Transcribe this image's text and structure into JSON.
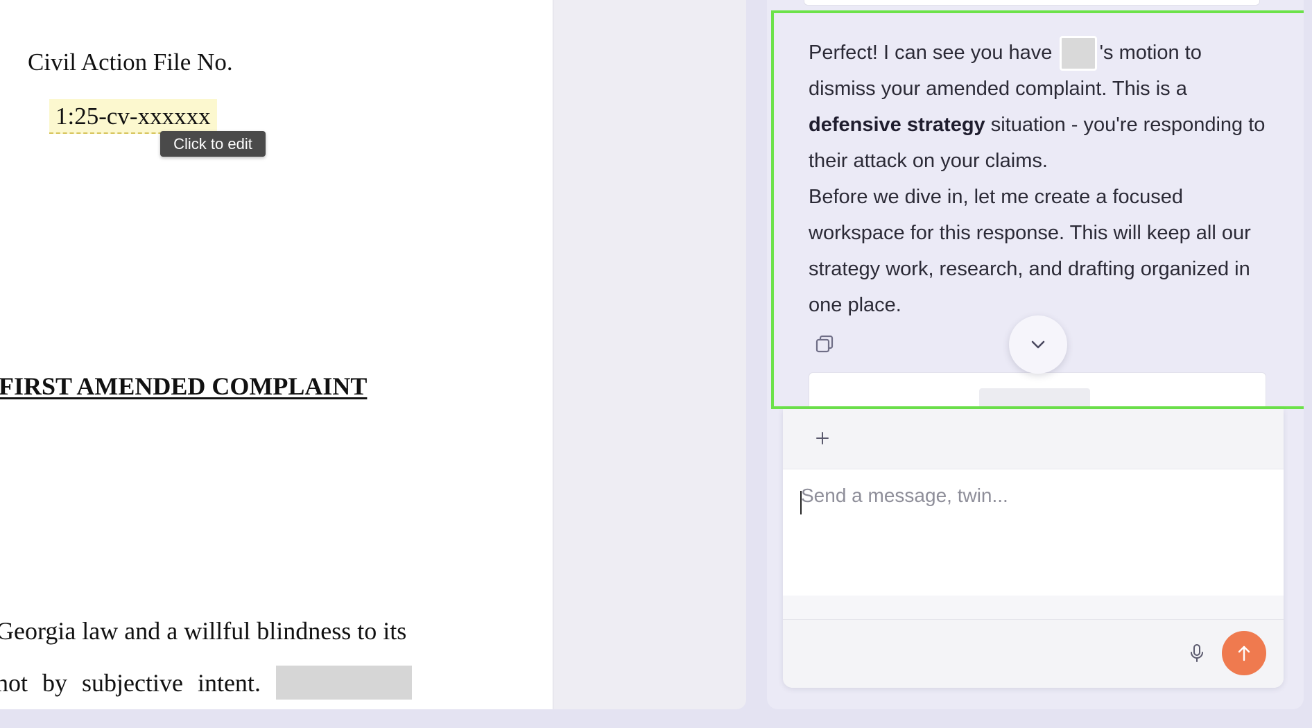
{
  "document": {
    "file_label": "Civil Action File No.",
    "case_number": "1:25-cv-xxxxxx",
    "tooltip": "Click to edit",
    "heading": "FIRST AMENDED COMPLAINT",
    "line_1": "Georgia law and a willful blindness to its",
    "line_2": "not by subjective intent."
  },
  "chat": {
    "message": {
      "p1_before": "Perfect! I can see you have ",
      "p1_after": "'s motion to dismiss your amended complaint. This is a ",
      "p1_bold": "defensive strategy",
      "p1_end": " situation - you're responding to their attack on your claims.",
      "p2": "Before we dive in, let me create a focused workspace for this response. This will keep all our strategy work, research, and drafting organized in one place."
    },
    "icons": {
      "copy": "copy-icon",
      "scroll_down": "chevron-down-icon",
      "add": "plus-icon",
      "mic": "microphone-icon",
      "send": "arrow-up-icon"
    },
    "composer": {
      "placeholder": "Send a message, twin...",
      "value": ""
    }
  },
  "colors": {
    "highlight_border": "#6ce24a",
    "send_button": "#ef7a4f",
    "field_highlight": "#fcf8cf",
    "panel_background": "#ebeaf6"
  }
}
